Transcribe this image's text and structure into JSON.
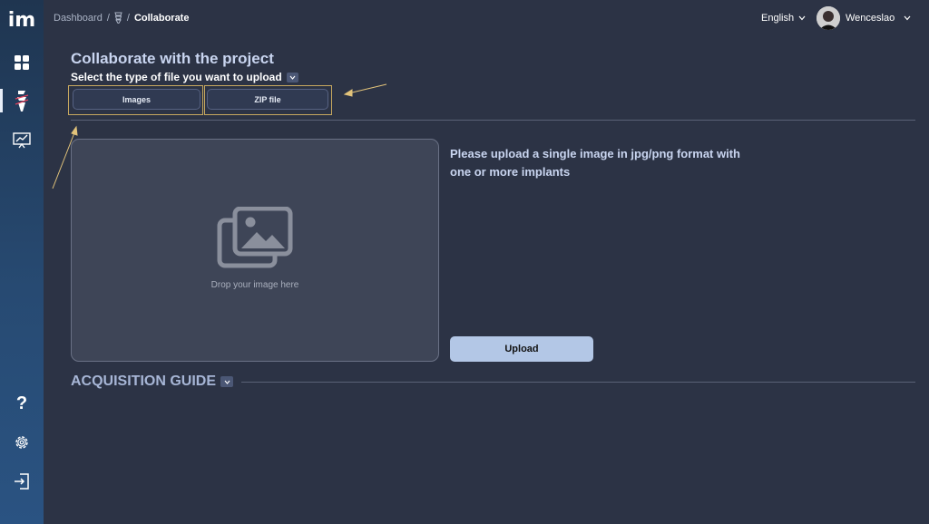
{
  "sidebar": {
    "logo_text": "im",
    "items": [
      {
        "name": "dashboard",
        "icon": "grid-icon",
        "active": false
      },
      {
        "name": "collaborate",
        "icon": "implant-icon",
        "active": true
      },
      {
        "name": "presentation",
        "icon": "monitor-chart-icon",
        "active": false
      }
    ],
    "bottom_items": [
      {
        "name": "help",
        "icon": "question-icon",
        "label": "?"
      },
      {
        "name": "settings",
        "icon": "gear-icon"
      },
      {
        "name": "logout",
        "icon": "logout-icon"
      }
    ]
  },
  "header": {
    "breadcrumb": {
      "home": "Dashboard",
      "separator": "/",
      "current": "Collaborate"
    },
    "language": "English",
    "username": "Wenceslao"
  },
  "main": {
    "title": "Collaborate with the project",
    "subtitle": "Select the type of file you want to upload",
    "file_types": [
      "Images",
      "ZIP file"
    ],
    "dropzone_text": "Drop your image here",
    "instructions": "Please upload a single image in jpg/png format with one or more implants",
    "upload_label": "Upload",
    "guide_title": "ACQUISITION GUIDE"
  },
  "colors": {
    "background": "#2c3345",
    "sidebar": "#274a72",
    "accent": "#b3c7e6",
    "highlight": "#c7a85f"
  }
}
